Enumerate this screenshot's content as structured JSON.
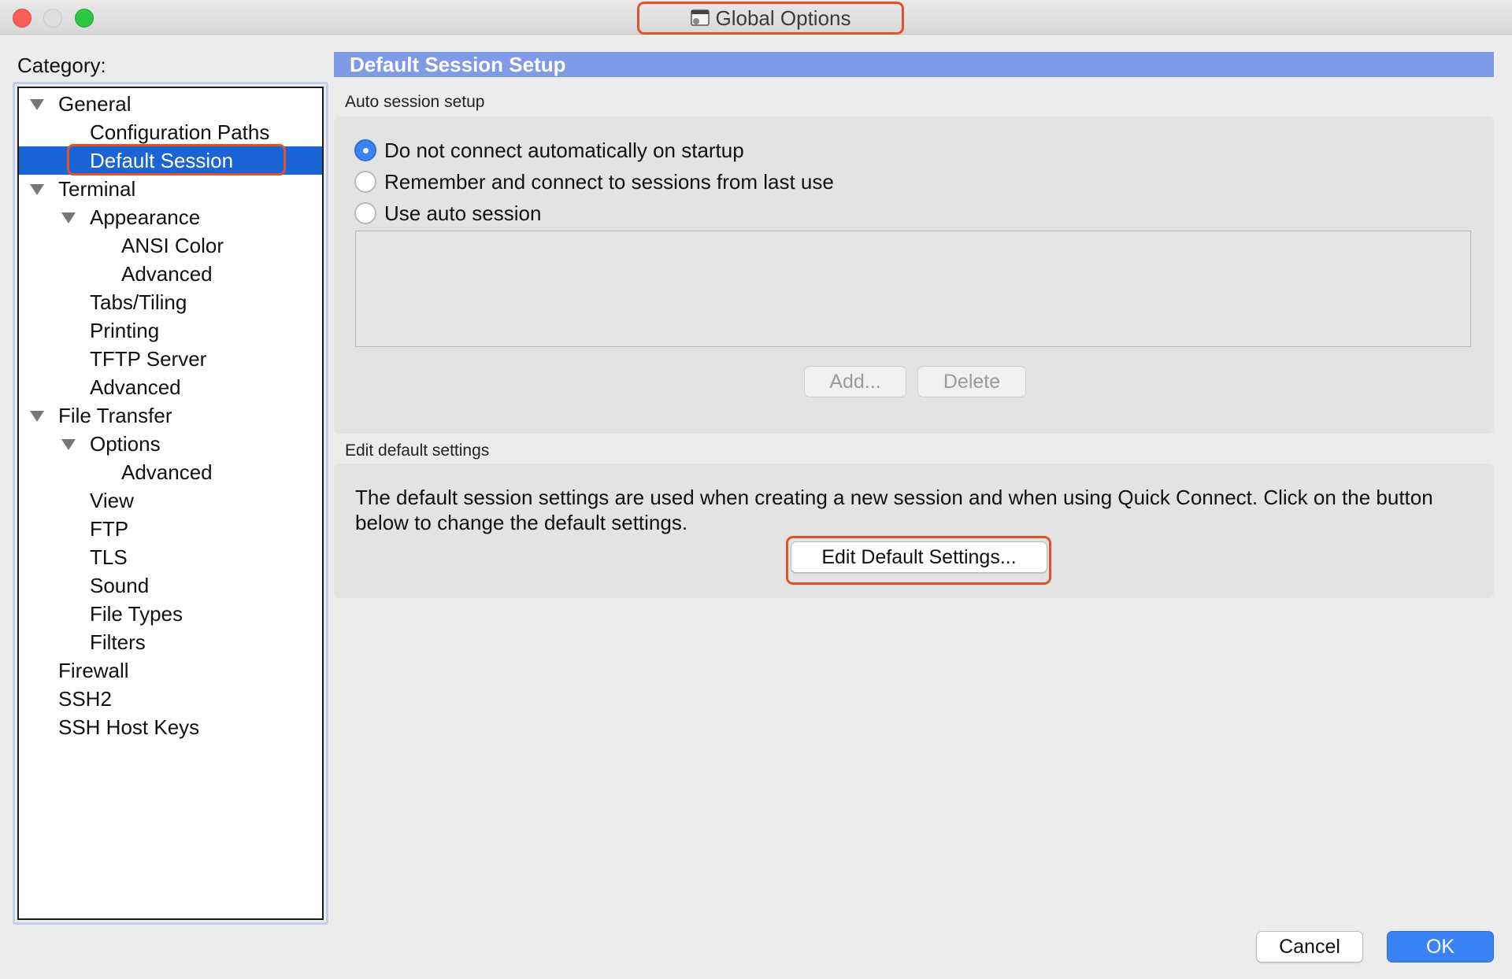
{
  "window": {
    "title": "Global Options"
  },
  "category": {
    "label": "Category:",
    "tree": [
      {
        "label": "General",
        "level": 0,
        "expandable": true
      },
      {
        "label": "Configuration Paths",
        "level": 1,
        "expandable": false
      },
      {
        "label": "Default Session",
        "level": 1,
        "expandable": false,
        "selected": true
      },
      {
        "label": "Terminal",
        "level": 0,
        "expandable": true
      },
      {
        "label": "Appearance",
        "level": 1,
        "expandable": true
      },
      {
        "label": "ANSI Color",
        "level": 2,
        "expandable": false
      },
      {
        "label": "Advanced",
        "level": 2,
        "expandable": false
      },
      {
        "label": "Tabs/Tiling",
        "level": 1,
        "expandable": false
      },
      {
        "label": "Printing",
        "level": 1,
        "expandable": false
      },
      {
        "label": "TFTP Server",
        "level": 1,
        "expandable": false
      },
      {
        "label": "Advanced",
        "level": 1,
        "expandable": false
      },
      {
        "label": "File Transfer",
        "level": 0,
        "expandable": true
      },
      {
        "label": "Options",
        "level": 1,
        "expandable": true
      },
      {
        "label": "Advanced",
        "level": 2,
        "expandable": false
      },
      {
        "label": "View",
        "level": 1,
        "expandable": false
      },
      {
        "label": "FTP",
        "level": 1,
        "expandable": false
      },
      {
        "label": "TLS",
        "level": 1,
        "expandable": false
      },
      {
        "label": "Sound",
        "level": 1,
        "expandable": false
      },
      {
        "label": "File Types",
        "level": 1,
        "expandable": false
      },
      {
        "label": "Filters",
        "level": 1,
        "expandable": false
      },
      {
        "label": "Firewall",
        "level": 0,
        "expandable": false
      },
      {
        "label": "SSH2",
        "level": 0,
        "expandable": false
      },
      {
        "label": "SSH Host Keys",
        "level": 0,
        "expandable": false
      }
    ]
  },
  "panel": {
    "header": "Default Session Setup",
    "auto_session": {
      "title": "Auto session setup",
      "options": [
        {
          "label": "Do not connect automatically on startup",
          "selected": true
        },
        {
          "label": "Remember and connect to sessions from last use",
          "selected": false
        },
        {
          "label": "Use auto session",
          "selected": false
        }
      ],
      "add_label": "Add...",
      "delete_label": "Delete"
    },
    "edit_defaults": {
      "title": "Edit default settings",
      "description": "The default session settings are used when creating a new session and when using Quick Connect.  Click on the button below to change the default settings.",
      "button_label": "Edit Default Settings..."
    }
  },
  "footer": {
    "cancel_label": "Cancel",
    "ok_label": "OK"
  },
  "colors": {
    "selection": "#1b64d6",
    "header": "#7f9ae6",
    "primary": "#3a82f6",
    "highlight": "#e2512a"
  }
}
